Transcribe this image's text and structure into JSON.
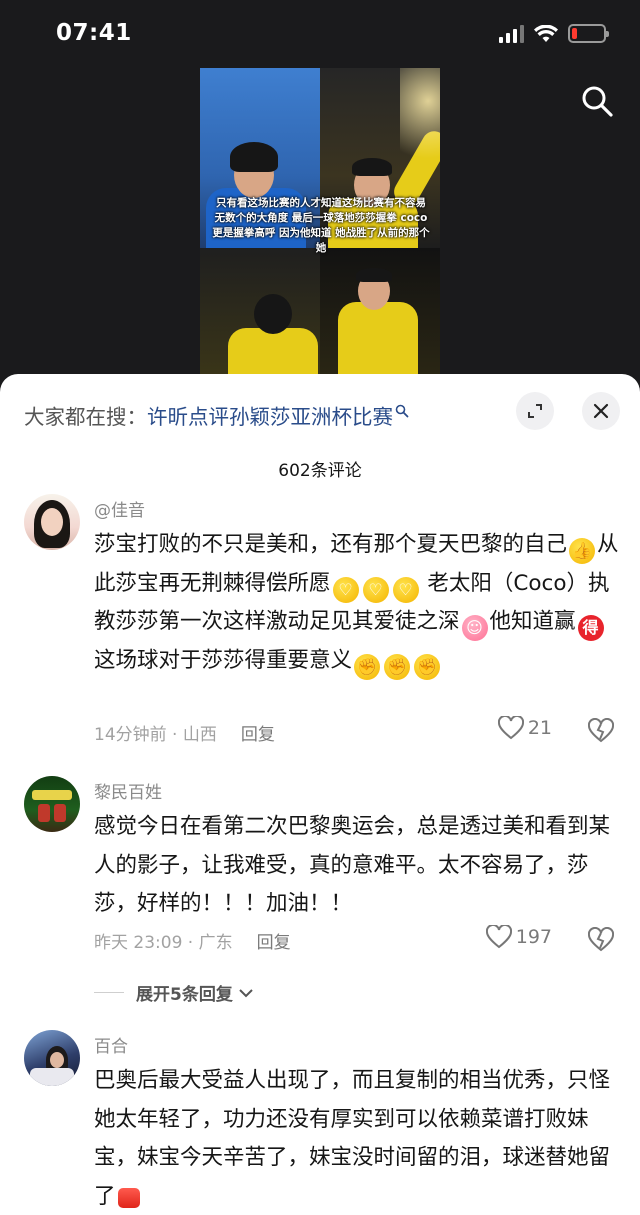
{
  "status": {
    "time": "07:41"
  },
  "video": {
    "caption": "只有看这场比赛的人才知道这场比赛有不容易 无数个的大角度 最后一球落地莎莎握拳 coco更是握拳高呼 因为他知道 她战胜了从前的那个她"
  },
  "sheet": {
    "hot_search_prefix": "大家都在搜：",
    "hot_search_query": "许昕点评孙颖莎亚洲杯比赛",
    "comment_count": "602条评论"
  },
  "comments": [
    {
      "user": "@佳音",
      "text_parts": [
        "莎宝打败的不只是美和，还有那个夏天巴黎的自己",
        "从此莎宝再无荆棘得偿所愿",
        "老太阳（Coco）执教莎莎第一次这样激动足见其爱徒之深",
        "他知道赢",
        "这场球对于莎莎得重要意义"
      ],
      "emoji_de": "得",
      "time": "14分钟前 · 山西",
      "reply": "回复",
      "likes": "21"
    },
    {
      "user": "黎民百姓",
      "text": "感觉今日在看第二次巴黎奥运会，总是透过美和看到某人的影子，让我难受，真的意难平。太不容易了，莎莎，好样的！！！加油！！",
      "time": "昨天 23:09 · 广东",
      "reply": "回复",
      "likes": "197",
      "expand": "展开5条回复"
    },
    {
      "user": "百合",
      "text": "巴奥后最大受益人出现了，而且复制的相当优秀，只怪她太年轻了，功力还没有厚实到可以依赖菜谱打败妹宝，妹宝今天辛苦了，妹宝没时间留的泪，球迷替她留了"
    }
  ],
  "icons": {
    "search": "search-icon",
    "expand": "expand-icon",
    "close": "close-icon",
    "like": "heart-icon",
    "dislike": "broken-heart-icon",
    "chevron": "chevron-down-icon"
  },
  "colors": {
    "link": "#2a4c8a",
    "battery_low": "#ff3b30"
  }
}
